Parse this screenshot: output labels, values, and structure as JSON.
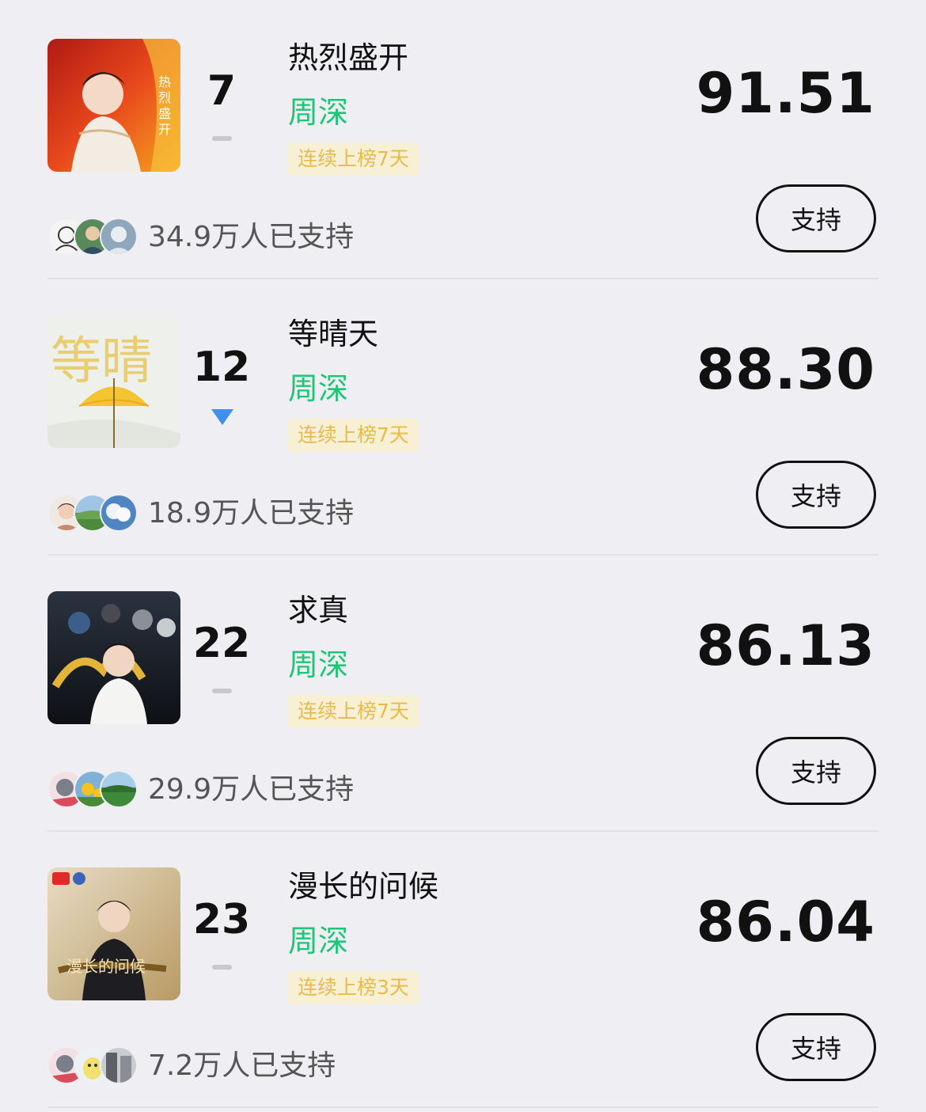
{
  "colors": {
    "background": "#efeff3",
    "artist": "#1fc476",
    "streak_text": "#e6bb4a",
    "streak_bg": "#f7f0d5",
    "trend_down": "#3f8ff0",
    "trend_flat": "#c8c8cc"
  },
  "entries": [
    {
      "rank": "7",
      "trend": "flat",
      "title": "热烈盛开",
      "artist": "周深",
      "streak": "连续上榜7天",
      "score": "91.51",
      "support_label": "支持",
      "supporters": "34.9万人已支持",
      "cover": "cover-art-red"
    },
    {
      "rank": "12",
      "trend": "down",
      "title": "等晴天",
      "artist": "周深",
      "streak": "连续上榜7天",
      "score": "88.30",
      "support_label": "支持",
      "supporters": "18.9万人已支持",
      "cover": "cover-art-umbrella"
    },
    {
      "rank": "22",
      "trend": "flat",
      "title": "求真",
      "artist": "周深",
      "streak": "连续上榜7天",
      "score": "86.13",
      "support_label": "支持",
      "supporters": "29.9万人已支持",
      "cover": "cover-art-dark"
    },
    {
      "rank": "23",
      "trend": "flat",
      "title": "漫长的问候",
      "artist": "周深",
      "streak": "连续上榜3天",
      "score": "86.04",
      "support_label": "支持",
      "supporters": "7.2万人已支持",
      "cover": "cover-art-gold"
    }
  ]
}
